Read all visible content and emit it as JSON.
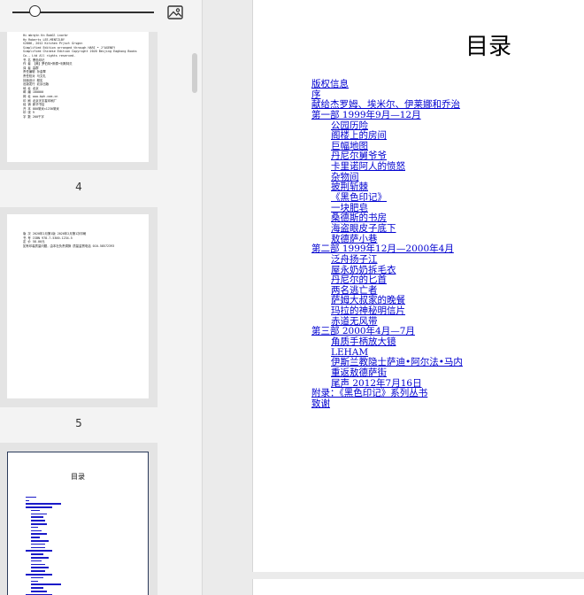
{
  "viewer": {
    "zoom_slider": {
      "level": 0.16
    },
    "image_icon": "image-icon",
    "colors": {
      "panel_bg": "#f3f3f3",
      "link": "#0000d0",
      "selected_border": "#2a3a5a"
    }
  },
  "thumbnails": [
    {
      "page_number": "4",
      "lines": [
        "Hi mbrgtn Kn BobGl Lnorbr",
        "Hy Roberts LEE-MENTZLBY",
        "©2006, 2012 Kitchen Prjsct Grsgnn",
        "Simplified Edition arranged through HARI • J\"AGENEY",
        "Simplified Chinese Edition Copyright 2020 Beijing Eaghong Books",
        "Co., Ltd All rights reserved.",
        "",
        "书 名 黑色印记",
        "作 者 【美】罗伯特•斯泰•利斯特贝",
        "译 者 高群",
        "责任编辑 孙金翠",
        "责任校对 马文礼",
        "封面设计 程实",
        "出版发行 北京出版",
        "地 址 北京",
        "邮 编 100000",
        "网 址 www.bph.com.cn",
        "印 刷 北京天宇星印刷厂",
        "经 销 新华书店",
        "开 本 880毫米×1230毫米",
        "印 张 9",
        "字 数 200千字"
      ]
    },
    {
      "page_number": "5",
      "lines": [
        "版 次 2020年2月第1版  2020年2月第1次印刷",
        "书 号 ISBN 978-7-5300-1234-5",
        "定 价 58.00元",
        "如有印装质量问题，由本社负责调换 质量监督电话 010-58572393"
      ]
    },
    {
      "page_number": "",
      "title": "目录",
      "toc_indents": [
        0,
        0,
        0,
        0,
        1,
        1,
        1,
        1,
        1,
        1,
        1,
        1,
        1,
        1,
        1,
        1,
        0,
        1,
        1,
        1,
        1,
        1,
        1,
        0,
        1,
        1,
        1,
        1,
        1,
        0,
        0
      ],
      "toc_widths": [
        12,
        4,
        40,
        30,
        10,
        18,
        14,
        16,
        18,
        8,
        12,
        18,
        10,
        20,
        16,
        16,
        30,
        14,
        20,
        12,
        16,
        20,
        16,
        30,
        14,
        8,
        34,
        14,
        18,
        30,
        8
      ]
    }
  ],
  "document": {
    "title": "目录",
    "toc": [
      {
        "text": "版权信息",
        "level": 1
      },
      {
        "text": "序",
        "level": 1
      },
      {
        "text": "献给杰罗姆、埃米尔、伊莱娜和乔治",
        "level": 1
      },
      {
        "text": "第一部  1999年9月—12月",
        "level": 1
      },
      {
        "text": "公园历险",
        "level": 2
      },
      {
        "text": "阁楼上的房间",
        "level": 2
      },
      {
        "text": "巨幅地图",
        "level": 2
      },
      {
        "text": "丹尼尔舅爷爷",
        "level": 2
      },
      {
        "text": "卡里诺阿人的愤怒",
        "level": 2
      },
      {
        "text": "杂物间",
        "level": 2
      },
      {
        "text": "披荆斩棘",
        "level": 2
      },
      {
        "text": "《黑色印记》",
        "level": 2
      },
      {
        "text": "一块肥皂",
        "level": 2
      },
      {
        "text": "桑德斯的书房",
        "level": 2
      },
      {
        "text": "海盗眼皮子底下",
        "level": 2
      },
      {
        "text": "敖德萨小巷",
        "level": 2
      },
      {
        "text": "第二部  1999年12月—2000年4月",
        "level": 1
      },
      {
        "text": "泛舟扬子江",
        "level": 2
      },
      {
        "text": "屋永奶奶拆毛衣",
        "level": 2
      },
      {
        "text": "丹尼尔的匕首",
        "level": 2
      },
      {
        "text": "两名逃亡者",
        "level": 2
      },
      {
        "text": "萨姆大叔家的晚餐",
        "level": 2
      },
      {
        "text": "玛拉的神秘明信片",
        "level": 2
      },
      {
        "text": "赤道无风带",
        "level": 2
      },
      {
        "text": "第三部  2000年4月—7月",
        "level": 1
      },
      {
        "text": "角质手柄放大镜",
        "level": 2
      },
      {
        "text": "LEHAM",
        "level": 2
      },
      {
        "text": "伊斯兰教隐士萨迪•阿尔法•马内",
        "level": 2
      },
      {
        "text": "重返敖德萨街",
        "level": 2
      },
      {
        "text": "尾声  2012年7月16日",
        "level": 2
      },
      {
        "text": "附录：《黑色印记》系列丛书",
        "level": 1
      },
      {
        "text": "致谢",
        "level": 1
      }
    ]
  }
}
